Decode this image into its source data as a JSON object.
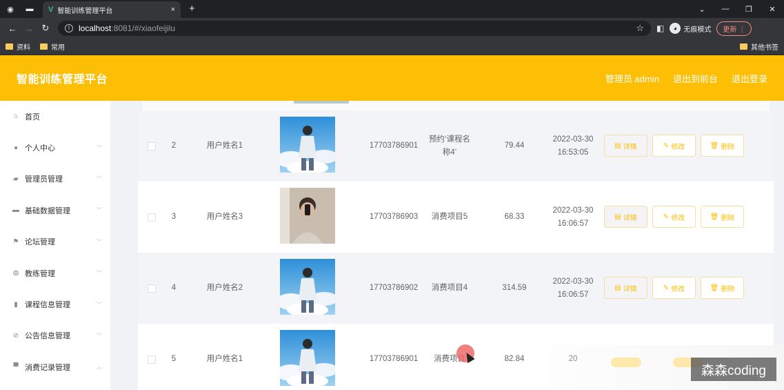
{
  "browser": {
    "tab_title": "智能训练管理平台",
    "tab_close": "×",
    "new_tab": "+",
    "url_host": "localhost",
    "url_rest": ":8081/#/xiaofeijilu",
    "incognito_label": "无痕模式",
    "update_label": "更新",
    "bookmarks": [
      "资料",
      "常用"
    ],
    "other_bookmarks": "其他书签"
  },
  "header": {
    "title": "智能训练管理平台",
    "admin": "管理员 admin",
    "to_front": "退出到前台",
    "logout": "退出登录"
  },
  "sidebar": {
    "items": [
      {
        "label": "首页",
        "icon": "home-icon",
        "chevron": ""
      },
      {
        "label": "个人中心",
        "icon": "user-icon",
        "chevron": "down"
      },
      {
        "label": "管理员管理",
        "icon": "admin-icon",
        "chevron": "down"
      },
      {
        "label": "基础数据管理",
        "icon": "data-icon",
        "chevron": "down"
      },
      {
        "label": "论坛管理",
        "icon": "flag-icon",
        "chevron": "down"
      },
      {
        "label": "教练管理",
        "icon": "coach-icon",
        "chevron": "down"
      },
      {
        "label": "课程信息管理",
        "icon": "course-icon",
        "chevron": "down"
      },
      {
        "label": "公告信息管理",
        "icon": "notice-icon",
        "chevron": "down"
      },
      {
        "label": "消费记录管理",
        "icon": "record-icon",
        "chevron": "up"
      }
    ]
  },
  "table": {
    "op_labels": {
      "detail": "详情",
      "edit": "修改",
      "delete": "删除"
    },
    "rows": [
      {
        "index": "2",
        "name": "用户姓名1",
        "phone": "17703786901",
        "item": "预约‘课程名称4’",
        "amount": "79.44",
        "time_date": "2022-03-30",
        "time_clock": "16:53:05",
        "avatar": "sky"
      },
      {
        "index": "3",
        "name": "用户姓名3",
        "phone": "17703786903",
        "item": "消费项目5",
        "amount": "68.33",
        "time_date": "2022-03-30",
        "time_clock": "16:06:57",
        "avatar": "selfie"
      },
      {
        "index": "4",
        "name": "用户姓名2",
        "phone": "17703786902",
        "item": "消费项目4",
        "amount": "314.59",
        "time_date": "2022-03-30",
        "time_clock": "16:06:57",
        "avatar": "sky"
      },
      {
        "index": "5",
        "name": "用户姓名1",
        "phone": "17703786901",
        "item": "消费项目",
        "amount": "82.84",
        "time_date": "20",
        "time_clock": "",
        "avatar": "sky"
      }
    ]
  },
  "watermark": "森森coding",
  "colors": {
    "accent": "#fcbf06",
    "header_bg": "#fcbf06"
  }
}
